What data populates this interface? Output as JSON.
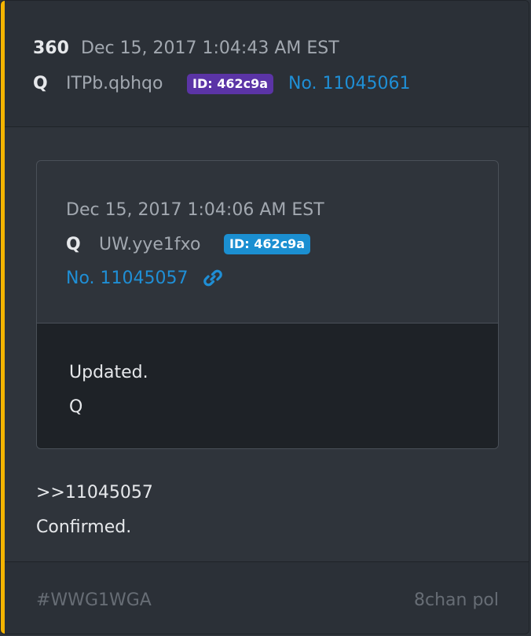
{
  "post": {
    "number": "360",
    "timestamp": "Dec 15, 2017 1:04:43 AM EST",
    "author": "Q",
    "tripcode": "ITPb.qbhqo",
    "id_badge": "ID: 462c9a",
    "post_link": "No. 11045061",
    "accent_color": "#f4b400"
  },
  "quoted_post": {
    "timestamp": "Dec 15, 2017 1:04:06 AM EST",
    "author": "Q",
    "tripcode": "UW.yye1fxo",
    "id_badge": "ID: 462c9a",
    "post_link": "No. 11045057",
    "link_icon": "chain-link-icon",
    "body_lines": [
      "Updated.",
      "Q"
    ]
  },
  "reply": {
    "lines": [
      ">>11045057",
      "Confirmed."
    ]
  },
  "footer": {
    "hashtag": "#WWG1WGA",
    "source": "8chan pol"
  }
}
